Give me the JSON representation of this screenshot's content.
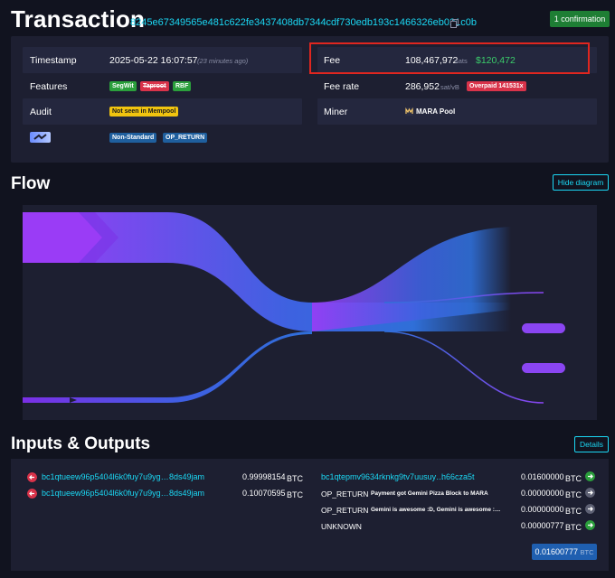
{
  "header": {
    "title": "Transaction",
    "txid": "8245e67349565e481c622fe3437408db7344cdf730edb193c1466326eb021c0b",
    "confirmations": "1 confirmation"
  },
  "summary": {
    "timestamp_label": "Timestamp",
    "timestamp_value": "2025-05-22 16:07:57",
    "timestamp_ago": "(23 minutes ago)",
    "features_label": "Features",
    "features": [
      "SegWit",
      "Taproot",
      "RBF"
    ],
    "audit_label": "Audit",
    "audit_value": "Not seen in Mempool",
    "tags": [
      "Non-Standard",
      "OP_RETURN"
    ],
    "fee_label": "Fee",
    "fee_sats": "108,467,972",
    "fee_unit": "sats",
    "fee_usd": "$120,472",
    "fee_rate_label": "Fee rate",
    "fee_rate_value": "286,952",
    "fee_rate_unit": "sat/vB",
    "overpaid": "Overpaid 141531x",
    "miner_label": "Miner",
    "miner_value": "MARA Pool"
  },
  "flow": {
    "title": "Flow",
    "hide_button": "Hide diagram"
  },
  "io": {
    "title": "Inputs & Outputs",
    "details_button": "Details",
    "inputs": [
      {
        "address": "bc1qtueew96p5404l6k0fuy7u9yg…",
        "address_end": "8ds49jam",
        "amount": "0.99998154",
        "unit": "BTC"
      },
      {
        "address": "bc1qtueew96p5404l6k0fuy7u9yg…",
        "address_end": "8ds49jam",
        "amount": "0.10070595",
        "unit": "BTC"
      }
    ],
    "outputs": [
      {
        "address": "bc1qtepmv9634rknkg9tv7uusuy…",
        "address_end": "h66cza5t",
        "amount": "0.01600000",
        "unit": "BTC"
      },
      {
        "label": "OP_RETURN",
        "data": "Payment got Gemini Pizza Block to MARA",
        "amount": "0.00000000",
        "unit": "BTC"
      },
      {
        "label": "OP_RETURN",
        "data": "Gemini is awesome :D, Gemini is awesome :…",
        "amount": "0.00000000",
        "unit": "BTC"
      },
      {
        "label": "UNKNOWN",
        "amount": "0.00000777",
        "unit": "BTC"
      }
    ],
    "total": "0.01600777",
    "total_unit": "BTC"
  },
  "colors": {
    "accent": "#1bd8f4",
    "background": "#11131f",
    "panel": "#1d1f31",
    "confirm_green": "#1e7e34",
    "highlight_red": "#e0261f",
    "flow_purple": "#9339f4",
    "flow_blue": "#2f6fd8"
  },
  "icons": [
    "copy-icon",
    "mara-logo",
    "lightning-rainbow-icon",
    "input-arrow-icon",
    "output-arrow-icon"
  ]
}
